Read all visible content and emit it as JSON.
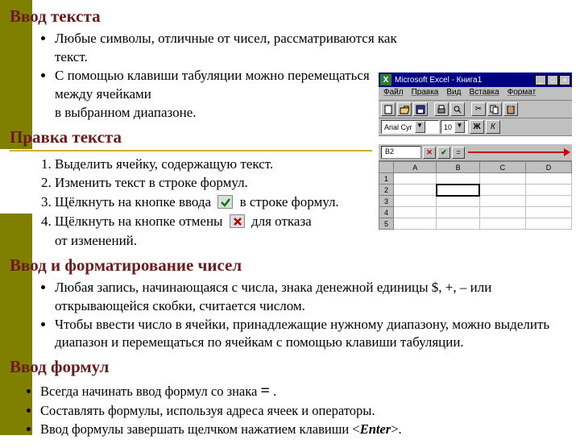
{
  "sections": {
    "s1": {
      "title": "Ввод текста",
      "b1": "Любые символы, отличные от чисел, рассматриваются как текст.",
      "b2": "С помощью клавиши табуляции можно перемещаться между ячейками",
      "b2b": "в выбранном диапазоне."
    },
    "s2": {
      "title": "Правка текста",
      "n1": "Выделить ячейку, содержащую текст.",
      "n2": "Изменить текст в строке формул.",
      "n3a": "Щёлкнуть на кнопке ввода ",
      "n3b": " в строке формул.",
      "n4a": "Щёлкнуть на кнопке отмены ",
      "n4b": " для отказа",
      "n4c": "от изменений."
    },
    "s3": {
      "title": "Ввод и форматирование чисел",
      "b1": "Любая запись, начинающаяся с числа, знака денежной единицы $, +, – или открывающейся скобки, считается числом.",
      "b2": "Чтобы ввести число в ячейки, принадлежащие нужному диапазону, можно выделить диапазон и перемещаться по ячейкам с помощью клавиши табуляции."
    },
    "s4": {
      "title": "Ввод формул",
      "b1a": "Всегда начинать ввод формул со знака ",
      "b1eq": "=",
      "b1b": " .",
      "b2": "Составлять формулы, используя адреса ячеек и операторы.",
      "b3a": "Ввод формулы завершать щелчком нажатием  клавиши  <",
      "b3k": "Enter",
      "b3b": ">."
    }
  },
  "excel": {
    "app": "Microsoft",
    "doc": "Excel - Книга1",
    "menu": {
      "m1": "Файл",
      "m2": "Правка",
      "m3": "Вид",
      "m4": "Вставка",
      "m5": "Формат"
    },
    "format": {
      "font": "Arial Cyr",
      "size": "10",
      "bold": "Ж",
      "italic": "К"
    },
    "namebox": "B2",
    "cols": {
      "a": "A",
      "b": "B",
      "c": "C",
      "d": "D"
    },
    "rows": {
      "r1": "1",
      "r2": "2",
      "r3": "3",
      "r4": "4",
      "r5": "5"
    }
  }
}
